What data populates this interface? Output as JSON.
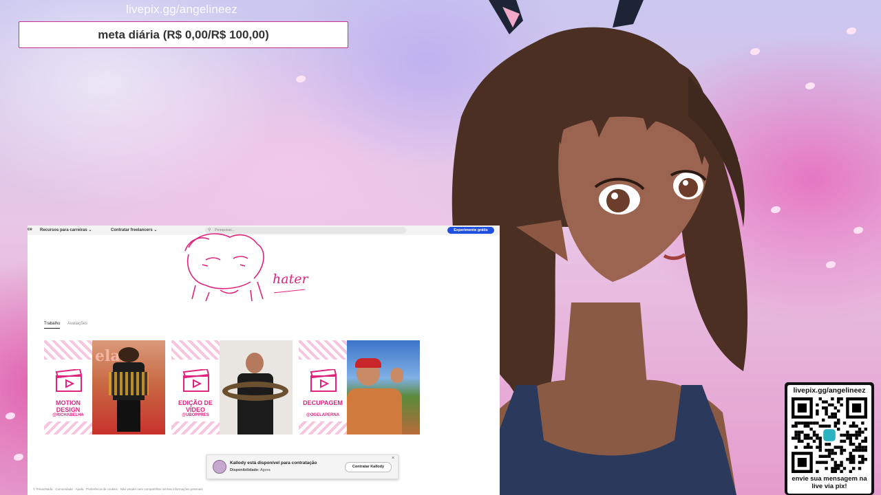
{
  "overlay": {
    "goal_url": "livepix.gg/angelineez",
    "goal_text": "meta diária (R$ 0,00/R$ 100,00)"
  },
  "browser": {
    "nav": {
      "cut_item": "ce",
      "item1": "Recursos para carreiras",
      "item2": "Contratar freelancers",
      "search_placeholder": "Pesquisar...",
      "cta": "Experimente grátis"
    },
    "banner_text": "hater",
    "tabs": [
      {
        "label": "Trabalho",
        "active": true
      },
      {
        "label": "Avaliações",
        "active": false
      }
    ],
    "cards": [
      {
        "title": "MOTION DESIGN",
        "handle": "@RICHABELHA",
        "photo_text": "elas"
      },
      {
        "title": "EDIÇÃO DE VÍDEO",
        "handle": "@UBOPPRES",
        "photo_text": ""
      },
      {
        "title": "DECUPAGEM",
        "handle": "@OGELAPERNA",
        "photo_text": ""
      }
    ],
    "toast": {
      "title": "Kallody está disponível para contratação",
      "availability_label": "Disponibilidade:",
      "availability_value": "Agora",
      "button": "Contratar Kallody"
    },
    "footer": "© PrivacMada · Comunidade · Ajuda · Preferência de cookies · Não vender nem compartilhar minhas informações pessoais"
  },
  "pix_widget": {
    "url": "livepix.gg/angelineez",
    "message": "envie sua mensagem na live via pix!"
  },
  "colors": {
    "accent_pink": "#e0237d",
    "goal_border": "#c8328c",
    "cta_blue": "#1f4fe0"
  }
}
